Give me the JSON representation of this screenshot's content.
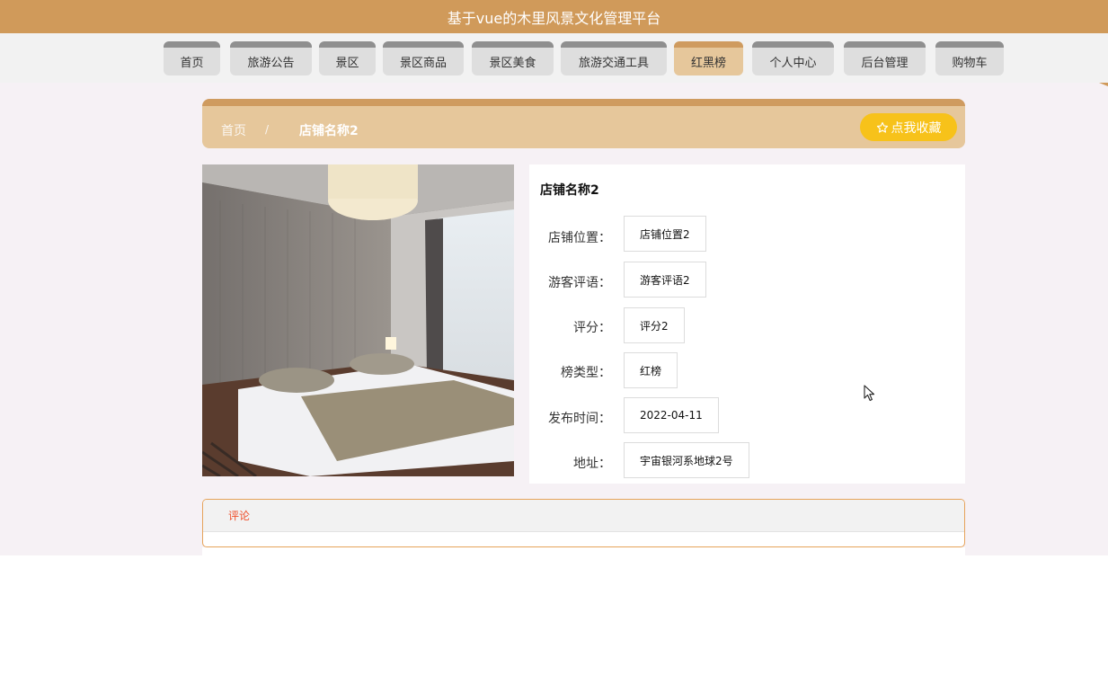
{
  "header": {
    "title": "基于vue的木里风景文化管理平台"
  },
  "nav": {
    "items": [
      {
        "label": "首页"
      },
      {
        "label": "旅游公告"
      },
      {
        "label": "景区"
      },
      {
        "label": "景区商品"
      },
      {
        "label": "景区美食"
      },
      {
        "label": "旅游交通工具"
      },
      {
        "label": "红黑榜"
      },
      {
        "label": "个人中心"
      },
      {
        "label": "后台管理"
      },
      {
        "label": "购物车"
      }
    ],
    "active_label": "红黑榜"
  },
  "breadcrumb": {
    "home": "首页",
    "separator": "/",
    "current": "店铺名称2"
  },
  "favorite_button": {
    "icon": "star-outline-icon",
    "label": "点我收藏"
  },
  "detail": {
    "title": "店铺名称2",
    "fields": [
      {
        "label": "店铺位置：",
        "value": "店铺位置2"
      },
      {
        "label": "游客评语：",
        "value": "游客评语2"
      },
      {
        "label": "评分：",
        "value": "评分2"
      },
      {
        "label": "榜类型：",
        "value": "红榜"
      },
      {
        "label": "发布时间：",
        "value": "2022-04-11"
      },
      {
        "label": "地址：",
        "value": "宇宙银河系地球2号"
      }
    ]
  },
  "comments": {
    "tab_label": "评论"
  },
  "colors": {
    "brand": "#d09a5a",
    "nav_active": "#e6c79b",
    "favorite": "#f7c21a",
    "comment_tab": "#ef4f2b"
  }
}
